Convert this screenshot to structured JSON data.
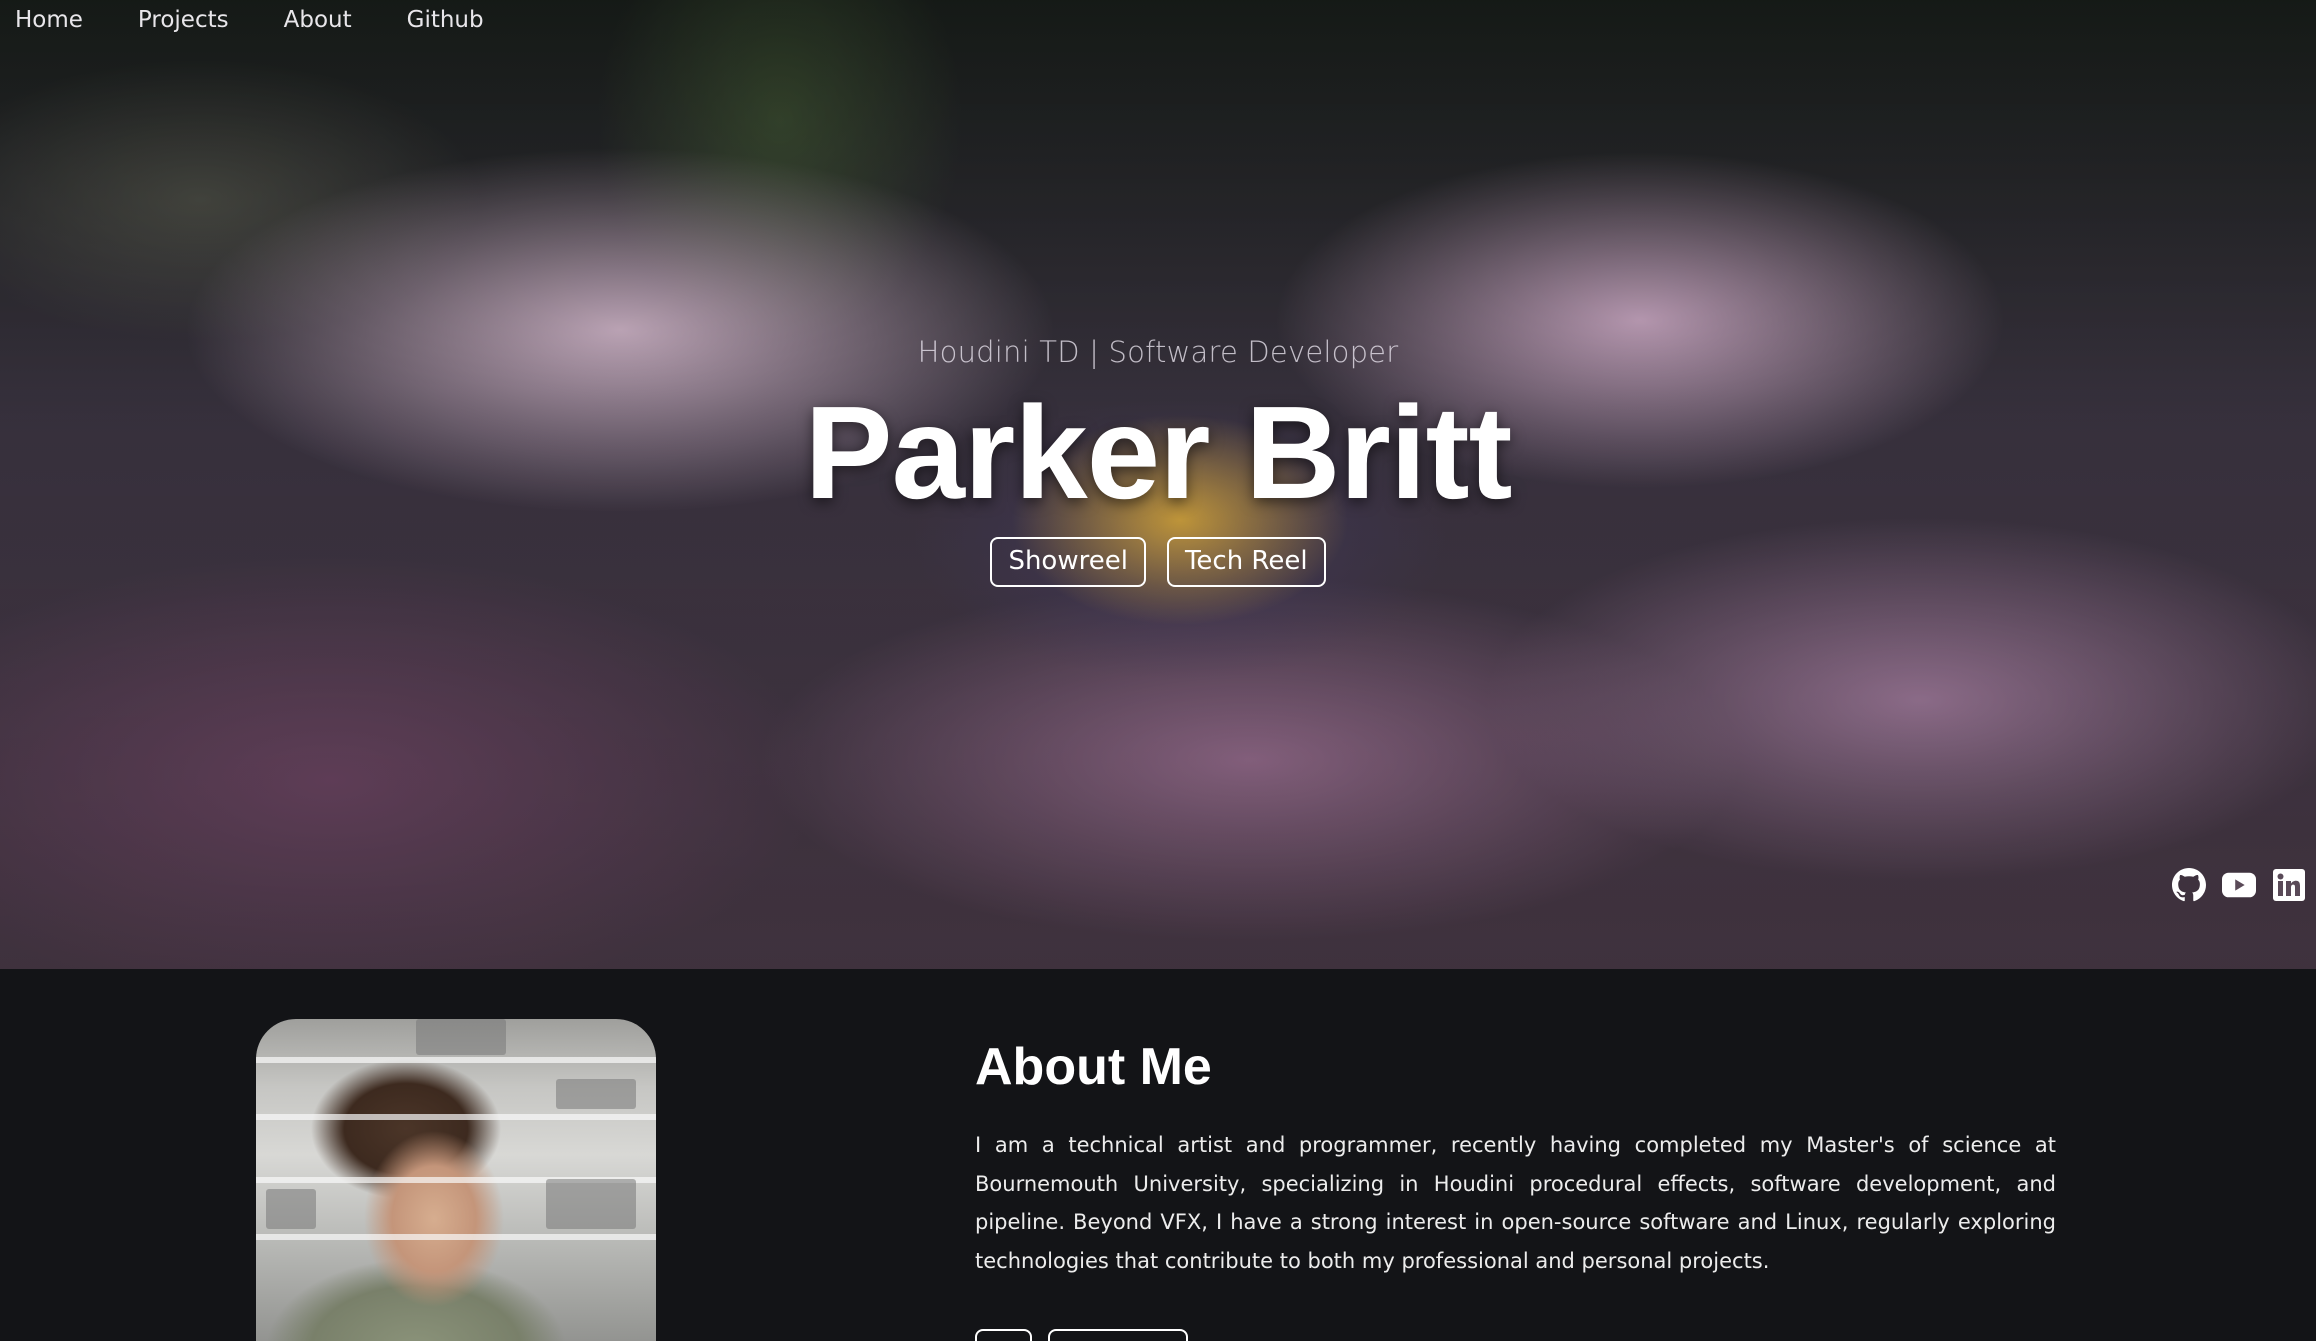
{
  "nav": {
    "items": [
      {
        "label": "Home"
      },
      {
        "label": "Projects"
      },
      {
        "label": "About"
      },
      {
        "label": "Github"
      }
    ]
  },
  "hero": {
    "tagline": "Houdini TD | Software Developer",
    "name": "Parker Britt",
    "buttons": [
      {
        "label": "Showreel"
      },
      {
        "label": "Tech Reel"
      }
    ],
    "socials": [
      {
        "icon": "github-icon"
      },
      {
        "icon": "youtube-icon"
      },
      {
        "icon": "linkedin-icon"
      }
    ]
  },
  "about": {
    "title": "About Me",
    "body": "I am a technical artist and programmer, recently having completed my Master's of science at Bournemouth University, specializing in Houdini procedural effects, software development, and pipeline. Beyond VFX, I have a strong interest in open-source software and Linux, regularly exploring technologies that contribute to both my professional and personal projects."
  },
  "colors": {
    "page_background": "#131417",
    "text": "#ffffff"
  }
}
